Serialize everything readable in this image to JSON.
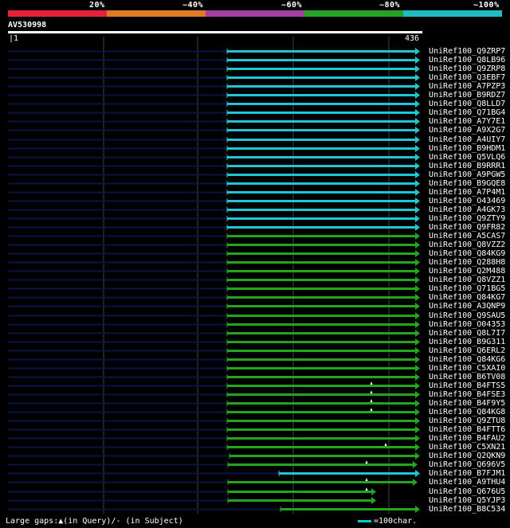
{
  "legend": {
    "labels": [
      "20%",
      "~40%",
      "~60%",
      "~80%",
      "~100%"
    ],
    "colors": [
      "#e8213b",
      "#e07b25",
      "#a63fa3",
      "#26a326",
      "#1fbcc0"
    ]
  },
  "query": {
    "name": "AV530998",
    "start": "1",
    "end": "436"
  },
  "hit_colors": {
    "cyan": "#1ec8d2",
    "green": "#23a51e",
    "gap_line": "#0a1446"
  },
  "hits": [
    {
      "id": "UniRef100_Q9ZRP7",
      "color": "cyan"
    },
    {
      "id": "UniRef100_Q8LB96",
      "color": "cyan"
    },
    {
      "id": "UniRef100_Q9ZRP8",
      "color": "cyan"
    },
    {
      "id": "UniRef100_Q3EBF7",
      "color": "cyan"
    },
    {
      "id": "UniRef100_A7PZP3",
      "color": "cyan"
    },
    {
      "id": "UniRef100_B9RDZ7",
      "color": "cyan"
    },
    {
      "id": "UniRef100_Q8LLD7",
      "color": "cyan"
    },
    {
      "id": "UniRef100_Q71BG4",
      "color": "cyan"
    },
    {
      "id": "UniRef100_A7Y7E1",
      "color": "cyan"
    },
    {
      "id": "UniRef100_A9X2G7",
      "color": "cyan"
    },
    {
      "id": "UniRef100_A4UIY7",
      "color": "cyan"
    },
    {
      "id": "UniRef100_B9HDM1",
      "color": "cyan"
    },
    {
      "id": "UniRef100_Q5VLQ6",
      "color": "cyan"
    },
    {
      "id": "UniRef100_B9RRR1",
      "color": "cyan"
    },
    {
      "id": "UniRef100_A9PGW5",
      "color": "cyan"
    },
    {
      "id": "UniRef100_B9GQE8",
      "color": "cyan"
    },
    {
      "id": "UniRef100_A7P4M1",
      "color": "cyan"
    },
    {
      "id": "UniRef100_O43469",
      "color": "cyan"
    },
    {
      "id": "UniRef100_A4GK73",
      "color": "cyan"
    },
    {
      "id": "UniRef100_Q9ZTY9",
      "color": "cyan"
    },
    {
      "id": "UniRef100_Q9FR82",
      "color": "cyan"
    },
    {
      "id": "UniRef100_A5CAS7",
      "color": "green"
    },
    {
      "id": "UniRef100_Q8VZZ2",
      "color": "green"
    },
    {
      "id": "UniRef100_Q84KG9",
      "color": "green"
    },
    {
      "id": "UniRef100_Q288H8",
      "color": "green"
    },
    {
      "id": "UniRef100_Q2M488",
      "color": "green"
    },
    {
      "id": "UniRef100_Q8VZZ1",
      "color": "green"
    },
    {
      "id": "UniRef100_Q71BG5",
      "color": "green"
    },
    {
      "id": "UniRef100_Q84KG7",
      "color": "green"
    },
    {
      "id": "UniRef100_A3QNP9",
      "color": "green"
    },
    {
      "id": "UniRef100_Q9SAU5",
      "color": "green"
    },
    {
      "id": "UniRef100_O04353",
      "color": "green"
    },
    {
      "id": "UniRef100_Q8L7I7",
      "color": "green"
    },
    {
      "id": "UniRef100_B9G311",
      "color": "green"
    },
    {
      "id": "UniRef100_Q6ERL2",
      "color": "green"
    },
    {
      "id": "UniRef100_Q84KG6",
      "color": "green"
    },
    {
      "id": "UniRef100_C5XAI0",
      "color": "green"
    },
    {
      "id": "UniRef100_B6TV08",
      "color": "green"
    },
    {
      "id": "UniRef100_B4FTS5",
      "color": "green"
    },
    {
      "id": "UniRef100_B4FSE3",
      "color": "green"
    },
    {
      "id": "UniRef100_B4F9Y5",
      "color": "green"
    },
    {
      "id": "UniRef100_Q84KG8",
      "color": "green"
    },
    {
      "id": "UniRef100_Q9ZTU8",
      "color": "green"
    },
    {
      "id": "UniRef100_B4FTT6",
      "color": "green"
    },
    {
      "id": "UniRef100_B4FAU2",
      "color": "green"
    },
    {
      "id": "UniRef100_C5XN21",
      "color": "green"
    },
    {
      "id": "UniRef100_Q2QKN9",
      "color": "green"
    },
    {
      "id": "UniRef100_Q696V5",
      "color": "green"
    },
    {
      "id": "UniRef100_B7FJM1",
      "color": "cyan"
    },
    {
      "id": "UniRef100_A9THU4",
      "color": "green"
    },
    {
      "id": "UniRef100_Q676U5",
      "color": "green"
    },
    {
      "id": "UniRef100_Q5YJP3",
      "color": "green"
    },
    {
      "id": "UniRef100_B8C534",
      "color": "green"
    }
  ],
  "footer": {
    "gaps_text": "Large gaps:▲(in Query)/- (in Subject)",
    "scale_text": "=100char."
  }
}
